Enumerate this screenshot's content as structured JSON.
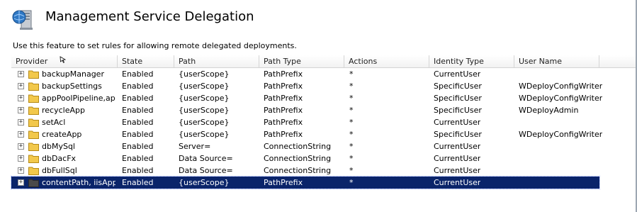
{
  "page": {
    "title": "Management Service Delegation",
    "description": "Use this feature to set rules for allowing remote delegated deployments.",
    "icon": "server-icon"
  },
  "columns": [
    "Provider",
    "State",
    "Path",
    "Path Type",
    "Actions",
    "Identity Type",
    "User Name"
  ],
  "rows": [
    {
      "provider": "backupManager",
      "state": "Enabled",
      "path": "{userScope}",
      "path_type": "PathPrefix",
      "actions": "*",
      "identity_type": "CurrentUser",
      "user_name": ""
    },
    {
      "provider": "backupSettings",
      "state": "Enabled",
      "path": "{userScope}",
      "path_type": "PathPrefix",
      "actions": "*",
      "identity_type": "SpecificUser",
      "user_name": "WDeployConfigWriter"
    },
    {
      "provider": "appPoolPipeline,ap...",
      "state": "Enabled",
      "path": "{userScope}",
      "path_type": "PathPrefix",
      "actions": "*",
      "identity_type": "SpecificUser",
      "user_name": "WDeployConfigWriter"
    },
    {
      "provider": "recycleApp",
      "state": "Enabled",
      "path": "{userScope}",
      "path_type": "PathPrefix",
      "actions": "*",
      "identity_type": "SpecificUser",
      "user_name": "WDeployAdmin"
    },
    {
      "provider": "setAcl",
      "state": "Enabled",
      "path": "{userScope}",
      "path_type": "PathPrefix",
      "actions": "*",
      "identity_type": "CurrentUser",
      "user_name": ""
    },
    {
      "provider": "createApp",
      "state": "Enabled",
      "path": "{userScope}",
      "path_type": "PathPrefix",
      "actions": "*",
      "identity_type": "SpecificUser",
      "user_name": "WDeployConfigWriter"
    },
    {
      "provider": "dbMySql",
      "state": "Enabled",
      "path": "Server=",
      "path_type": "ConnectionString",
      "actions": "*",
      "identity_type": "CurrentUser",
      "user_name": ""
    },
    {
      "provider": "dbDacFx",
      "state": "Enabled",
      "path": "Data Source=",
      "path_type": "ConnectionString",
      "actions": "*",
      "identity_type": "CurrentUser",
      "user_name": ""
    },
    {
      "provider": "dbFullSql",
      "state": "Enabled",
      "path": "Data Source=",
      "path_type": "ConnectionString",
      "actions": "*",
      "identity_type": "CurrentUser",
      "user_name": ""
    },
    {
      "provider": "contentPath, iisApp",
      "state": "Enabled",
      "path": "{userScope}",
      "path_type": "PathPrefix",
      "actions": "*",
      "identity_type": "CurrentUser",
      "user_name": "",
      "selected": true
    }
  ],
  "expander_glyph": "+",
  "colors": {
    "selection": "#0a246a",
    "folder": "#f2c84b"
  }
}
